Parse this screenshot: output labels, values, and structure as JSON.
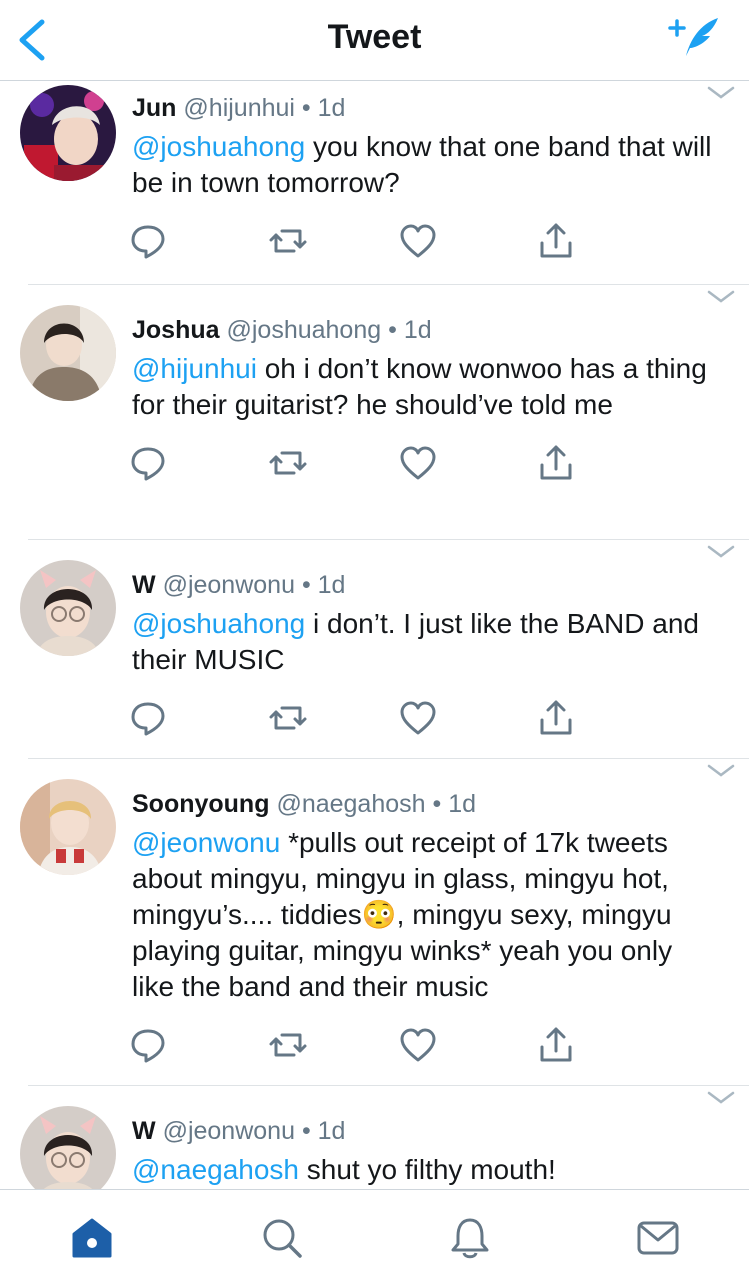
{
  "header": {
    "title": "Tweet",
    "back_icon": "chevron-left-icon",
    "compose_icon": "compose-tweet-icon",
    "accent_color": "#1da1f2"
  },
  "tweets": [
    {
      "name": "Jun",
      "handle": "@hijunhui",
      "dot": "•",
      "time": "1d",
      "mention": "@joshuahong",
      "text": " you know that one band that will be in town tomorrow?"
    },
    {
      "name": "Joshua",
      "handle": "@joshuahong",
      "dot": "•",
      "time": "1d",
      "mention": "@hijunhui",
      "text": " oh i don’t know wonwoo has a thing for their guitarist? he should’ve told me"
    },
    {
      "name": "W",
      "handle": "@jeonwonu",
      "dot": "•",
      "time": "1d",
      "mention": "@joshuahong",
      "text": " i don’t. I just like the BAND and their MUSIC"
    },
    {
      "name": "Soonyoung",
      "handle": "@naegahosh",
      "dot": "•",
      "time": "1d",
      "mention": "@jeonwonu",
      "text": " *pulls out receipt of 17k tweets about mingyu, mingyu in glass, mingyu hot, mingyu’s.... tiddies😳, mingyu sexy, mingyu playing guitar, mingyu winks* yeah you only like the band and their music"
    },
    {
      "name": "W",
      "handle": "@jeonwonu",
      "dot": "•",
      "time": "1d",
      "mention": "@naegahosh",
      "text": " shut yo filthy mouth!"
    }
  ],
  "tweet_actions": [
    "reply-icon",
    "retweet-icon",
    "like-icon",
    "share-icon"
  ],
  "tabbar": {
    "items": [
      "home-icon",
      "search-icon",
      "notifications-icon",
      "messages-icon"
    ],
    "active": "home-icon"
  }
}
